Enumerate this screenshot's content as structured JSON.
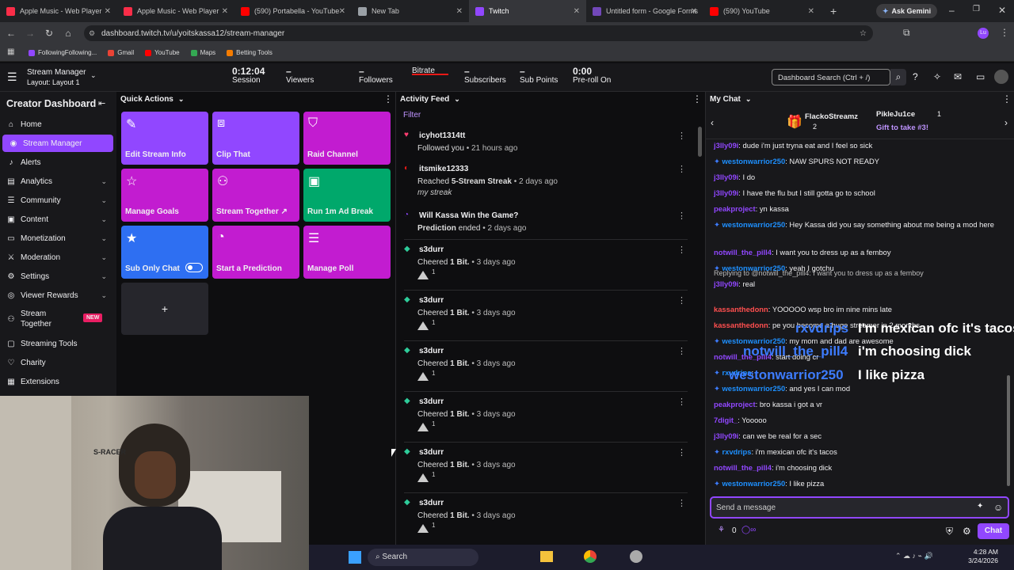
{
  "browser": {
    "tabs": [
      {
        "title": "Apple Music - Web Player",
        "color": "#fa2d48"
      },
      {
        "title": "Apple Music - Web Player",
        "color": "#fa2d48"
      },
      {
        "title": "(590) Portabella - YouTube",
        "color": "#ff0000"
      },
      {
        "title": "New Tab",
        "color": "#9aa0a6"
      },
      {
        "title": "Twitch",
        "color": "#9147ff"
      },
      {
        "title": "Untitled form - Google Forms",
        "color": "#7248b9"
      },
      {
        "title": "(590) YouTube",
        "color": "#ff0000"
      }
    ],
    "ask_gemini": "Ask Gemini",
    "url": "dashboard.twitch.tv/u/yoitskassa12/stream-manager",
    "bookmarks": [
      "FollowingFollowing...",
      "Gmail",
      "YouTube",
      "Maps",
      "Betting Tools"
    ]
  },
  "header": {
    "title": "Stream Manager",
    "layout": "Layout: Layout 1",
    "stats": [
      {
        "value": "0:12:04",
        "label": "Session"
      },
      {
        "value": "–",
        "label": "Viewers"
      },
      {
        "value": "–",
        "label": "Followers"
      },
      {
        "value": "",
        "label": "Bitrate"
      },
      {
        "value": "–",
        "label": "Subscribers"
      },
      {
        "value": "–",
        "label": "Sub Points"
      },
      {
        "value": "0:00",
        "label": "Pre-roll On"
      }
    ],
    "search_placeholder": "Dashboard Search (Ctrl + /)"
  },
  "sidebar": {
    "title": "Creator Dashboard",
    "items": [
      {
        "label": "Home",
        "icon": "home-icon",
        "chev": false
      },
      {
        "label": "Stream Manager",
        "icon": "broadcast-icon",
        "chev": false,
        "active": true
      },
      {
        "label": "Alerts",
        "icon": "bell-icon",
        "chev": false
      },
      {
        "label": "Analytics",
        "icon": "chart-icon",
        "chev": true
      },
      {
        "label": "Community",
        "icon": "people-icon",
        "chev": true
      },
      {
        "label": "Content",
        "icon": "content-icon",
        "chev": true
      },
      {
        "label": "Monetization",
        "icon": "money-icon",
        "chev": true
      },
      {
        "label": "Moderation",
        "icon": "sword-icon",
        "chev": true
      },
      {
        "label": "Settings",
        "icon": "gear-icon",
        "chev": true
      },
      {
        "label": "Viewer Rewards",
        "icon": "reward-icon",
        "chev": true
      },
      {
        "label": "Stream Together",
        "icon": "together-icon",
        "badge": "NEW"
      },
      {
        "label": "Streaming Tools",
        "icon": "tools-icon"
      },
      {
        "label": "Charity",
        "icon": "charity-icon"
      },
      {
        "label": "Extensions",
        "icon": "puzzle-icon"
      }
    ]
  },
  "quick_actions": {
    "title": "Quick Actions",
    "items": [
      {
        "label": "Edit Stream Info",
        "icon": "pencil-icon",
        "color": "#9147ff"
      },
      {
        "label": "Clip That",
        "icon": "clip-icon",
        "color": "#9147ff"
      },
      {
        "label": "Raid Channel",
        "icon": "raid-icon",
        "color": "#c21cd0"
      },
      {
        "label": "Manage Goals",
        "icon": "star-outline-icon",
        "color": "#c21cd0"
      },
      {
        "label": "Stream Together ↗",
        "icon": "add-person-icon",
        "color": "#c21cd0"
      },
      {
        "label": "Run 1m Ad Break",
        "icon": "ad-icon",
        "color": "#00a86b"
      },
      {
        "label": "Sub Only Chat",
        "icon": "star-icon",
        "color": "#2e6ff2"
      },
      {
        "label": "Start a Prediction",
        "icon": "prediction-icon",
        "color": "#c21cd0"
      },
      {
        "label": "Manage Poll",
        "icon": "poll-icon",
        "color": "#c21cd0"
      }
    ],
    "add": "+"
  },
  "activity": {
    "title": "Activity Feed",
    "filter": "Filter",
    "items": [
      {
        "name": "icyhot1314tt",
        "line1a": "Followed",
        "line1b": " you",
        "line1c": " • 21 hours ago",
        "line2": "",
        "icon": "heart-icon"
      },
      {
        "name": "itsmike12333",
        "line1a": "Reached ",
        "line1b": "5-Stream Streak",
        "line1c": " • 2 days ago",
        "line2": "my streak",
        "icon": "streak-icon"
      },
      {
        "name": "Will Kassa Win the Game?",
        "line1a": "Prediction",
        "line1b": " ended",
        "line1c": " • 2 days ago",
        "line2": "",
        "icon": "prediction-icon"
      },
      {
        "name": "s3durr",
        "line1a": "Cheered ",
        "line1b": "1 Bit.",
        "line1c": " • 3 days ago",
        "line2": "1",
        "icon": "bits-icon"
      },
      {
        "name": "s3durr",
        "line1a": "Cheered ",
        "line1b": "1 Bit.",
        "line1c": " • 3 days ago",
        "line2": "1",
        "icon": "bits-icon"
      },
      {
        "name": "s3durr",
        "line1a": "Cheered ",
        "line1b": "1 Bit.",
        "line1c": " • 3 days ago",
        "line2": "1",
        "icon": "bits-icon"
      },
      {
        "name": "s3durr",
        "line1a": "Cheered ",
        "line1b": "1 Bit.",
        "line1c": " • 3 days ago",
        "line2": "1",
        "icon": "bits-icon"
      },
      {
        "name": "s3durr",
        "line1a": "Cheered ",
        "line1b": "1 Bit.",
        "line1c": " • 3 days ago",
        "line2": "1",
        "icon": "bits-icon"
      },
      {
        "name": "s3durr",
        "line1a": "Cheered ",
        "line1b": "1 Bit.",
        "line1c": " • 3 days ago",
        "line2": "1",
        "icon": "bits-icon"
      }
    ]
  },
  "chat": {
    "title": "My Chat",
    "gift_user": "FlackoStreamz",
    "gift_count": "2",
    "gift_user2": "PikleJu1ce",
    "gift_count2": "1",
    "gift_cta": "Gift to take #3!",
    "messages": [
      {
        "user": "j3lly09i",
        "c": "p",
        "text": "dude i'm just tryna eat and I feel so sick"
      },
      {
        "user": "westonwarrior250",
        "c": "b",
        "text": "NAW SPURS NOT READY"
      },
      {
        "user": "j3lly09i",
        "c": "p",
        "text": "I do"
      },
      {
        "user": "j3lly09i",
        "c": "p",
        "text": "I have the flu but I still gotta go to school"
      },
      {
        "user": "peakproject",
        "c": "p",
        "text": "yn kassa"
      },
      {
        "user": "westonwarrior250",
        "c": "b",
        "text": "Hey Kassa did you say something about me being a mod here"
      },
      {
        "user": "notwill_the_pill4",
        "c": "p",
        "text": "I want you to dress up as a femboy"
      },
      {
        "user": "westonwarrior250",
        "c": "b",
        "text": "yeah I gotchu"
      },
      {
        "user": "j3lly09i",
        "c": "p",
        "text": "real",
        "reply": "Replying to @notwill_the_pill4: I want you to dress up as a femboy"
      },
      {
        "user": "kassanthedonn",
        "c": "r",
        "text": "YOOOOO wsp bro im nine mins late"
      },
      {
        "user": "kassanthedonn",
        "c": "r",
        "text": "pe you become a huge streamer in 2 months"
      },
      {
        "user": "westonwarrior250",
        "c": "b",
        "text": "my mom and dad are awesome"
      },
      {
        "user": "notwill_the_pill4",
        "c": "p",
        "text": "start doing cr"
      },
      {
        "user": "rxvdrips",
        "c": "b",
        "text": ""
      },
      {
        "user": "westonwarrior250",
        "c": "b",
        "text": "and yes I can mod"
      },
      {
        "user": "peakproject",
        "c": "p",
        "text": "bro kassa i got a vr"
      },
      {
        "user": "7digit_",
        "c": "p",
        "text": "Yooooo"
      },
      {
        "user": "j3lly09i",
        "c": "p",
        "text": "can we be real for a sec"
      },
      {
        "user": "rxvdrips",
        "c": "b",
        "text": "i'm mexican ofc it's tacos"
      },
      {
        "user": "notwill_the_pill4",
        "c": "p",
        "text": "i'm choosing dick"
      },
      {
        "user": "westonwarrior250",
        "c": "b",
        "text": "I like pizza"
      }
    ],
    "overlay": [
      {
        "user": "rxvdrips",
        "text": "I'm mexican ofc it's tacos"
      },
      {
        "user": "notwill_the_pill4",
        "text": "i'm choosing dick"
      },
      {
        "user": "westonwarrior250",
        "text": "I like pizza"
      }
    ],
    "input_placeholder": "Send a message",
    "points": "0",
    "send": "Chat"
  },
  "taskbar": {
    "search": "Search",
    "time": "4:28 AM",
    "date": "3/24/2026"
  }
}
